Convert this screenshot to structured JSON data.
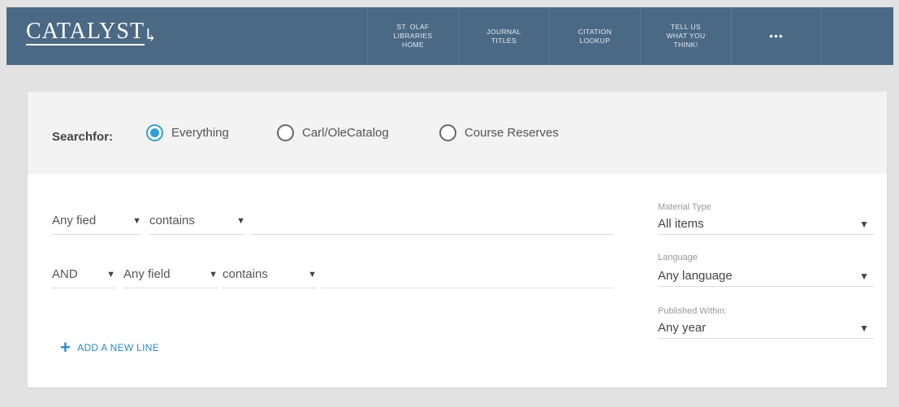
{
  "header": {
    "logo": "CATALYST",
    "nav": [
      {
        "label": "St. Olaf\nLibraries\nHome"
      },
      {
        "label": "Journal\nTitles"
      },
      {
        "label": "Citation\nLookup"
      },
      {
        "label": "Tell us\nwhat you\nthink!"
      },
      {
        "label": "•••"
      }
    ]
  },
  "search": {
    "searchfor_label": "Searchfor:",
    "options": [
      {
        "label": "Everything",
        "selected": true
      },
      {
        "label": "Carl/OleCatalog",
        "selected": false
      },
      {
        "label": "Course Reserves",
        "selected": false
      }
    ]
  },
  "query": {
    "row1": {
      "field": "Any fied",
      "operator": "contains",
      "value": ""
    },
    "row2": {
      "bool": "AND",
      "field": "Any field",
      "operator": "contains",
      "value": ""
    },
    "add_line": "ADD A NEW LINE"
  },
  "filters": {
    "material_type": {
      "label": "Material Type",
      "value": "All items"
    },
    "language": {
      "label": "Language",
      "value": "Any language"
    },
    "published": {
      "label": "Published Within:",
      "value": "Any year"
    }
  },
  "colors": {
    "header_bg": "#4a6985",
    "accent": "#2f9fd2",
    "link": "#2f89c5"
  }
}
